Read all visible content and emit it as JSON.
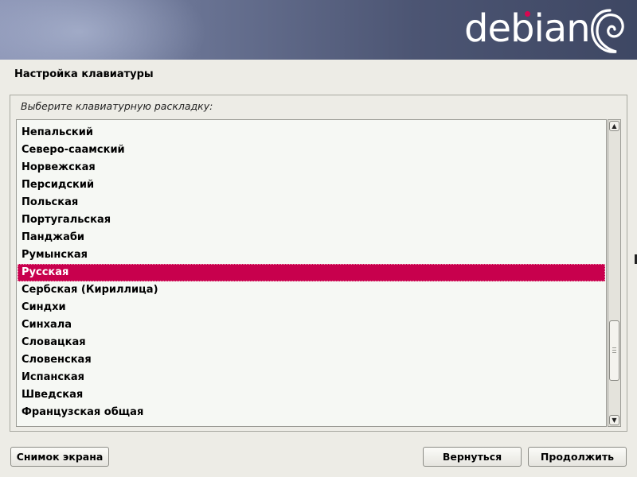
{
  "header": {
    "logo_text": "debian"
  },
  "page": {
    "title": "Настройка клавиатуры",
    "prompt": "Выберите клавиатурную раскладку:"
  },
  "layout_list": {
    "items": [
      "Непальский",
      "Северо-саамский",
      "Норвежская",
      "Персидский",
      "Польская",
      "Португальская",
      "Панджаби",
      "Румынская",
      "Русская",
      "Сербская (Кириллица)",
      "Синдхи",
      "Синхала",
      "Словацкая",
      "Словенская",
      "Испанская",
      "Шведская",
      "Французская общая",
      ""
    ],
    "selected_index": 8,
    "selected_value": "Русская"
  },
  "buttons": {
    "screenshot": "Снимок экрана",
    "back": "Вернуться",
    "continue": "Продолжить"
  },
  "colors": {
    "accent": "#c8004d",
    "logo_dot": "#d70751",
    "background": "#edece6",
    "list_background": "#f6f8f4"
  },
  "icons": {
    "logo_swirl": "debian-swirl-icon",
    "scroll_up": "arrow-up-icon",
    "scroll_down": "arrow-down-icon"
  }
}
